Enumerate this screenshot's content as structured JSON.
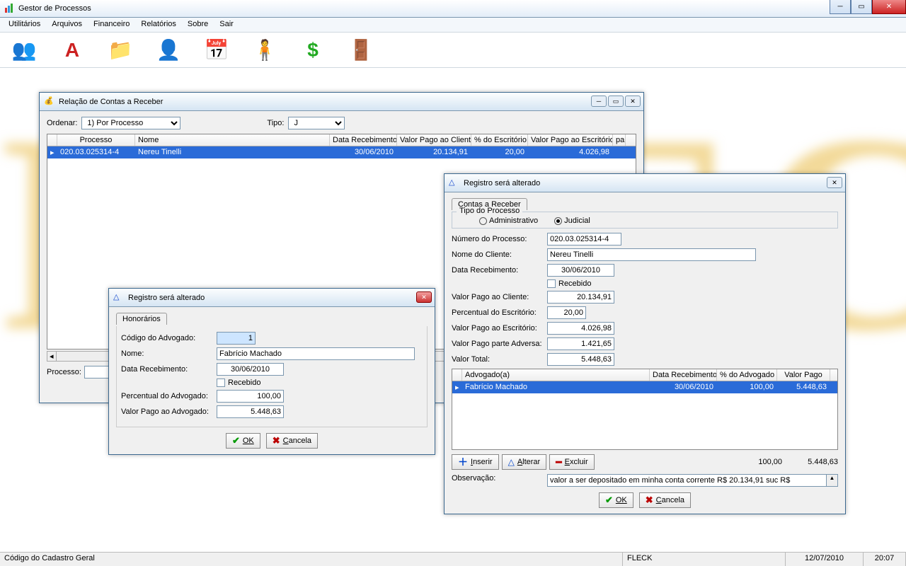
{
  "app": {
    "title": "Gestor de Processos"
  },
  "menu": [
    "Utilitários",
    "Arquivos",
    "Financeiro",
    "Relatórios",
    "Sobre",
    "Sair"
  ],
  "win1": {
    "title": "Relação de Contas a Receber",
    "ordenar_label": "Ordenar:",
    "ordenar_value": "1) Por Processo",
    "tipo_label": "Tipo:",
    "tipo_value": "J",
    "cols": [
      "Processo",
      "Nome",
      "Data Recebimento",
      "Valor Pago ao Cliente",
      "% do Escritório",
      "Valor Pago ao Escritório",
      "pa"
    ],
    "row": {
      "processo": "020.03.025314-4",
      "nome": "Nereu Tinelli",
      "data": "30/06/2010",
      "vpc": "20.134,91",
      "pct": "20,00",
      "vpe": "4.026,98",
      "pa": ""
    },
    "processo_label": "Processo:"
  },
  "win2": {
    "title": "Registro será alterado",
    "tab": "Honorários",
    "codigo_label": "Código do Advogado:",
    "codigo": "1",
    "nome_label": "Nome:",
    "nome": "Fabrício Machado",
    "data_label": "Data Recebimento:",
    "data": "30/06/2010",
    "recebido_label": "Recebido",
    "pct_label": "Percentual do Advogado:",
    "pct": "100,00",
    "vpa_label": "Valor Pago ao Advogado:",
    "vpa": "5.448,63",
    "ok": "OK",
    "cancela": "Cancela"
  },
  "win3": {
    "title": "Registro será alterado",
    "tab": "Contas a Receber",
    "grp": "Tipo do Processo",
    "opt1": "Administrativo",
    "opt2": "Judicial",
    "num_label": "Número do Processo:",
    "num": "020.03.025314-4",
    "nome_label": "Nome do Cliente:",
    "nome": "Nereu Tinelli",
    "data_label": "Data Recebimento:",
    "data": "30/06/2010",
    "recebido": "Recebido",
    "vpc_label": "Valor Pago ao Cliente:",
    "vpc": "20.134,91",
    "pesc_label": "Percentual do Escritório:",
    "pesc": "20,00",
    "vpe_label": "Valor Pago ao Escritório:",
    "vpe": "4.026,98",
    "vppa_label": "Valor Pago parte Adversa:",
    "vppa": "1.421,65",
    "vt_label": "Valor Total:",
    "vt": "5.448,63",
    "gcols": [
      "Advogado(a)",
      "Data Recebimento",
      "% do Advogado",
      "Valor Pago"
    ],
    "grow": {
      "adv": "Fabrício Machado",
      "data": "30/06/2010",
      "pct": "100,00",
      "vp": "5.448,63"
    },
    "tot_pct": "100,00",
    "tot_vp": "5.448,63",
    "inserir": "Inserir",
    "alterar": "Alterar",
    "excluir": "Excluir",
    "obs_label": "Observação:",
    "obs": "valor a ser depositado em minha conta corrente R$ 20.134,91 suc R$",
    "ok": "OK",
    "cancela": "Cancela"
  },
  "status": {
    "s1": "Código do Cadastro Geral",
    "s2": "FLECK",
    "s3": "12/07/2010",
    "s4": "20:07"
  }
}
